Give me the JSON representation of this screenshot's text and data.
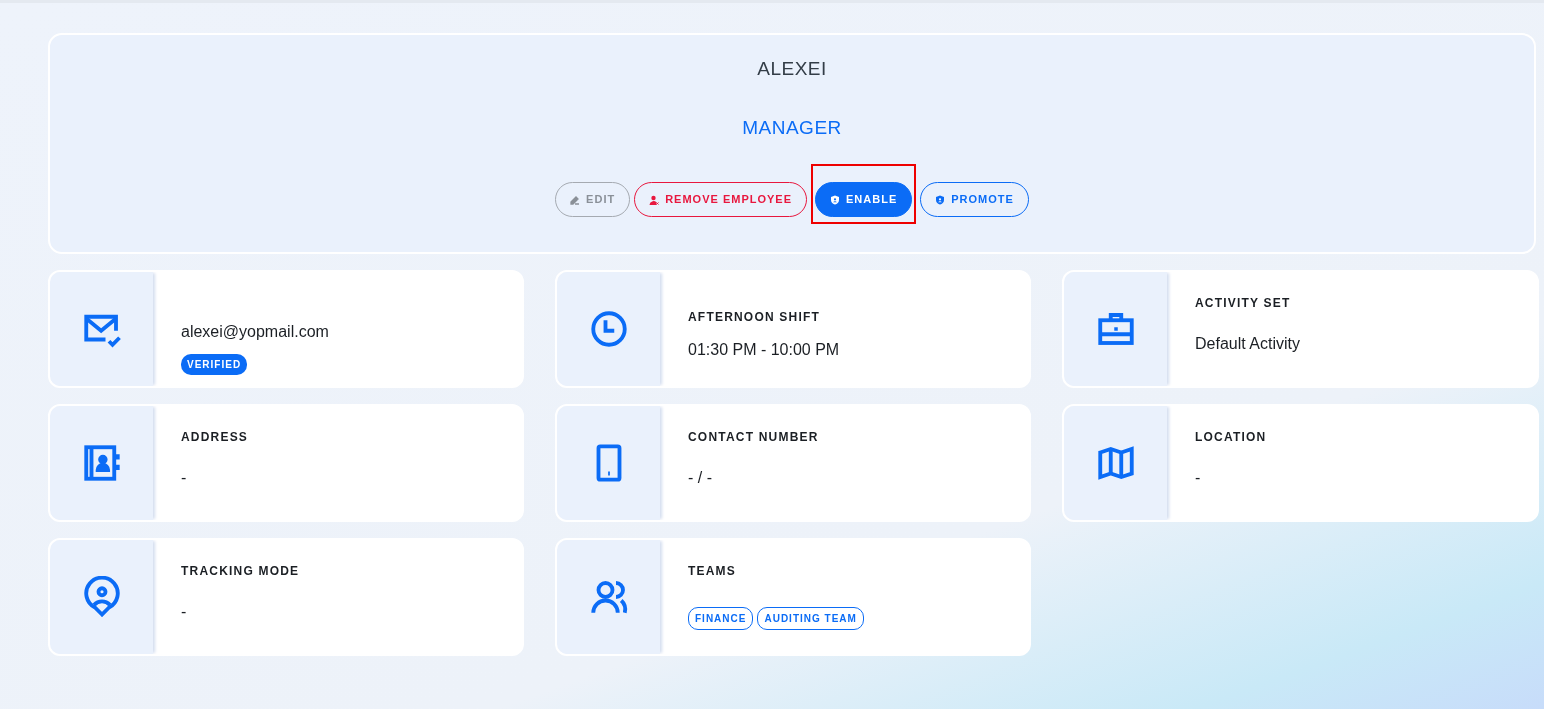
{
  "profile": {
    "name": "ALEXEI",
    "role": "MANAGER",
    "buttons": [
      {
        "kind": "edit",
        "label": "EDIT",
        "disabled": true,
        "highlighted": false
      },
      {
        "kind": "remove",
        "label": "REMOVE EMPLOYEE",
        "disabled": false,
        "highlighted": false
      },
      {
        "kind": "enable",
        "label": "ENABLE",
        "disabled": false,
        "highlighted": true
      },
      {
        "kind": "promote",
        "label": "PROMOTE",
        "disabled": false,
        "highlighted": false
      }
    ]
  },
  "cards": [
    {
      "kind": "email",
      "value": "alexei@yopmail.com",
      "badge": "VERIFIED"
    },
    {
      "kind": "shift",
      "label": "AFTERNOON SHIFT",
      "value": "01:30 PM - 10:00 PM"
    },
    {
      "kind": "activity",
      "label": "ACTIVITY SET",
      "value": "Default Activity"
    },
    {
      "kind": "address",
      "label": "ADDRESS",
      "value": "-"
    },
    {
      "kind": "contact",
      "label": "CONTACT NUMBER",
      "value": "- / -"
    },
    {
      "kind": "location",
      "label": "LOCATION",
      "value": "-"
    },
    {
      "kind": "tracking",
      "label": "TRACKING MODE",
      "value": "-"
    },
    {
      "kind": "teams",
      "label": "TEAMS",
      "tags": [
        "FINANCE",
        "AUDITING TEAM"
      ]
    }
  ]
}
